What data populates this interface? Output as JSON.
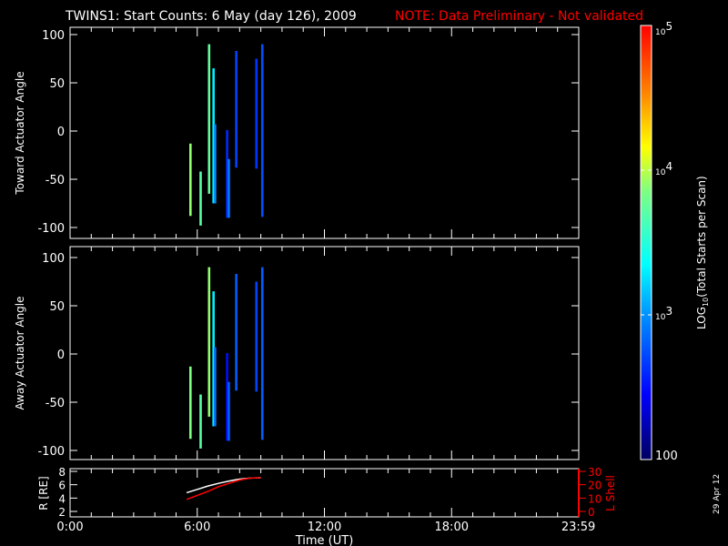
{
  "title": {
    "main": "TWINS1: Start Counts:  6 May (day 126), 2009",
    "note": "NOTE: Data Preliminary - Not validated",
    "note_color": "#ff0000"
  },
  "side_date": "29 Apr 12",
  "chart_data": [
    {
      "type": "heatmap",
      "name": "toward",
      "ylabel": "Toward Actuator Angle",
      "ylim": [
        -110,
        110
      ],
      "yticks": [
        100,
        50,
        0,
        -50,
        -100
      ],
      "ytick_labels": [
        "100",
        "50",
        "0",
        "-50",
        "-100"
      ],
      "xlim_hours": [
        0,
        24
      ],
      "stripes": [
        {
          "hour": 5.68,
          "angle_min": -88,
          "angle_max": -13,
          "log_counts": 3.9
        },
        {
          "hour": 6.16,
          "angle_min": -98,
          "angle_max": -42,
          "log_counts": 3.7
        },
        {
          "hour": 6.56,
          "angle_min": -65,
          "angle_max": 90,
          "log_counts": 3.75
        },
        {
          "hour": 6.77,
          "angle_min": -75,
          "angle_max": 65,
          "log_counts": 3.3
        },
        {
          "hour": 6.84,
          "angle_min": -75,
          "angle_max": 7,
          "log_counts": 3.0
        },
        {
          "hour": 7.41,
          "angle_min": -90,
          "angle_max": 1,
          "log_counts": 2.6
        },
        {
          "hour": 7.49,
          "angle_min": -90,
          "angle_max": -29,
          "log_counts": 2.9
        },
        {
          "hour": 7.84,
          "angle_min": -38,
          "angle_max": 83,
          "log_counts": 2.7
        },
        {
          "hour": 8.79,
          "angle_min": -39,
          "angle_max": 75,
          "log_counts": 2.65
        },
        {
          "hour": 9.07,
          "angle_min": -89,
          "angle_max": 90,
          "log_counts": 2.75
        }
      ]
    },
    {
      "type": "heatmap",
      "name": "away",
      "ylabel": "Away Actuator Angle",
      "ylim": [
        -110,
        110
      ],
      "yticks": [
        100,
        50,
        0,
        -50,
        -100
      ],
      "ytick_labels": [
        "100",
        "50",
        "0",
        "-50",
        "-100"
      ],
      "xlim_hours": [
        0,
        24
      ],
      "stripes": [
        {
          "hour": 5.68,
          "angle_min": -88,
          "angle_max": -13,
          "log_counts": 3.85
        },
        {
          "hour": 6.16,
          "angle_min": -98,
          "angle_max": -42,
          "log_counts": 3.7
        },
        {
          "hour": 6.56,
          "angle_min": -65,
          "angle_max": 90,
          "log_counts": 3.9
        },
        {
          "hour": 6.77,
          "angle_min": -75,
          "angle_max": 65,
          "log_counts": 3.3
        },
        {
          "hour": 6.84,
          "angle_min": -75,
          "angle_max": 7,
          "log_counts": 2.9
        },
        {
          "hour": 7.41,
          "angle_min": -90,
          "angle_max": 1,
          "log_counts": 2.5
        },
        {
          "hour": 7.49,
          "angle_min": -90,
          "angle_max": -29,
          "log_counts": 2.8
        },
        {
          "hour": 7.84,
          "angle_min": -38,
          "angle_max": 83,
          "log_counts": 2.8
        },
        {
          "hour": 8.79,
          "angle_min": -39,
          "angle_max": 75,
          "log_counts": 2.7
        },
        {
          "hour": 9.07,
          "angle_min": -89,
          "angle_max": 90,
          "log_counts": 2.8
        }
      ]
    },
    {
      "type": "line",
      "name": "orbit",
      "ylabel": "R [RE]",
      "ylabel_right": "L Shell",
      "ylim": [
        2,
        8
      ],
      "yticks": [
        2,
        4,
        6,
        8
      ],
      "ytick_labels": [
        "2",
        "4",
        "6",
        "8"
      ],
      "ylim_right": [
        0,
        30
      ],
      "yticks_right": [
        0,
        10,
        20,
        30
      ],
      "ytick_labels_right": [
        "0",
        "10",
        "20",
        "30"
      ],
      "xlabel": "Time (UT)",
      "xticks_hours": [
        0,
        6,
        12,
        18,
        23.983
      ],
      "xtick_labels": [
        "0:00",
        "6:00",
        "12:00",
        "18:00",
        "23:59"
      ],
      "series": [
        {
          "name": "R",
          "color": "#ffffff",
          "x": [
            5.5,
            6.0,
            6.5,
            7.0,
            7.5,
            8.0,
            8.5,
            9.0
          ],
          "y": [
            4.8,
            5.3,
            5.8,
            6.2,
            6.55,
            6.85,
            7.0,
            7.05
          ]
        },
        {
          "name": "L Shell",
          "color": "#ff0000",
          "x": [
            5.5,
            6.0,
            6.5,
            7.0,
            7.5,
            8.0,
            8.5,
            9.0
          ],
          "y": [
            9,
            12,
            15,
            18.5,
            21,
            23.5,
            25,
            25.2
          ]
        }
      ]
    }
  ],
  "colorbar": {
    "label": "LOG10(Total Starts per Scan)",
    "label_prefix": "LOG",
    "label_sub": "10",
    "label_suffix": "(Total Starts per Scan)",
    "range_log": [
      2,
      5
    ],
    "ticks": [
      {
        "value": 5,
        "base": "10",
        "exp": "5"
      },
      {
        "value": 4,
        "base": "10",
        "exp": "4"
      },
      {
        "value": 3,
        "base": "10",
        "exp": "3"
      },
      {
        "value": 2,
        "base": "100",
        "exp": ""
      }
    ]
  }
}
